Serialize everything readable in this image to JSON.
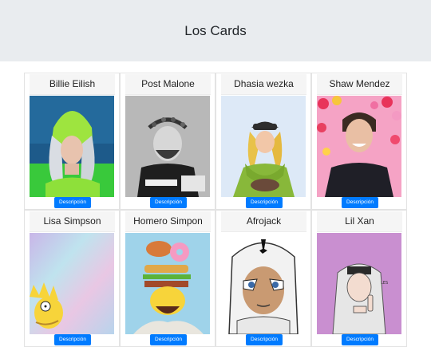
{
  "header": {
    "title": "Los Cards"
  },
  "cards": [
    {
      "name": "Billie Eilish",
      "button_label": "Descripción"
    },
    {
      "name": "Post Malone",
      "button_label": "Descripción"
    },
    {
      "name": "Dhasia wezka",
      "button_label": "Descripción"
    },
    {
      "name": "Shaw Mendez",
      "button_label": "Descripción"
    },
    {
      "name": "Lisa Simpson",
      "button_label": "Descripción"
    },
    {
      "name": "Homero Simpon",
      "button_label": "Descripción"
    },
    {
      "name": "Afrojack",
      "button_label": "Descripción"
    },
    {
      "name": "Lil Xan",
      "button_label": "Descripción"
    }
  ],
  "colors": {
    "header_bg": "#e9ecef",
    "button": "#007bff"
  }
}
